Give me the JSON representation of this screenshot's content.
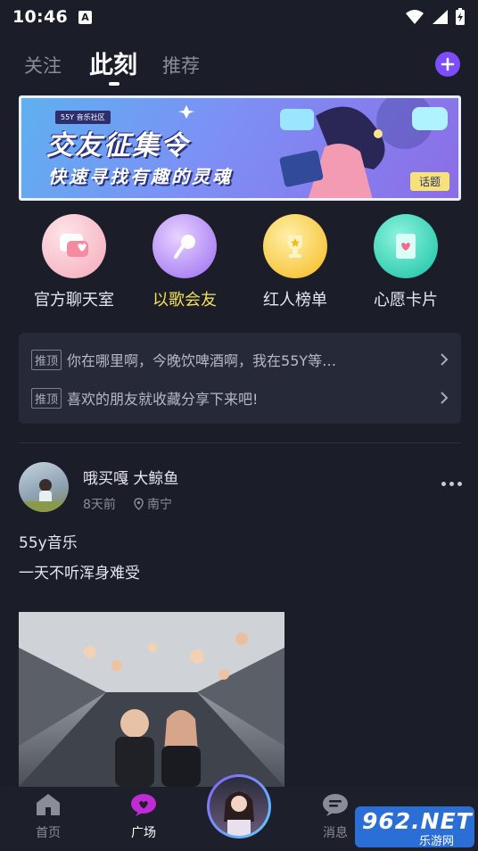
{
  "status_bar": {
    "time": "10:46",
    "notification_letter": "A"
  },
  "tabs": [
    {
      "label": "关注"
    },
    {
      "label": "此刻"
    },
    {
      "label": "推荐"
    }
  ],
  "banner": {
    "brand": "55Y 音乐社区",
    "title": "交友征集令",
    "subtitle": "快速寻找有趣的灵魂",
    "tag": "话题"
  },
  "quick_actions": [
    {
      "label": "官方聊天室",
      "icon": "chat-room-icon",
      "color": "#f6c1c9"
    },
    {
      "label": "以歌会友",
      "icon": "microphone-icon",
      "color": "#c79bff"
    },
    {
      "label": "红人榜单",
      "icon": "trophy-icon",
      "color": "#f7c837"
    },
    {
      "label": "心愿卡片",
      "icon": "wish-card-icon",
      "color": "#27d1b5"
    }
  ],
  "notices": [
    {
      "tag": "推顶",
      "text": "你在哪里啊，今晚饮啤酒啊，我在55Y等…"
    },
    {
      "tag": "推顶",
      "text": "喜欢的朋友就收藏分享下来吧!"
    }
  ],
  "post": {
    "username": "哦买嘎 大鲸鱼",
    "time": "8天前",
    "location": "南宁",
    "line1": "55y音乐",
    "line2": "一天不听浑身难受"
  },
  "bottom_nav": [
    {
      "label": "首页",
      "icon": "home-icon"
    },
    {
      "label": "广场",
      "icon": "plaza-icon"
    },
    {
      "label": "消息",
      "icon": "message-icon"
    }
  ],
  "watermark": {
    "text": "962.NET",
    "sub": "乐游网"
  },
  "colors": {
    "background": "#1b1d29",
    "accent": "#7c4dff",
    "highlight": "#f3e05a",
    "plaza": "#c12bd6"
  }
}
